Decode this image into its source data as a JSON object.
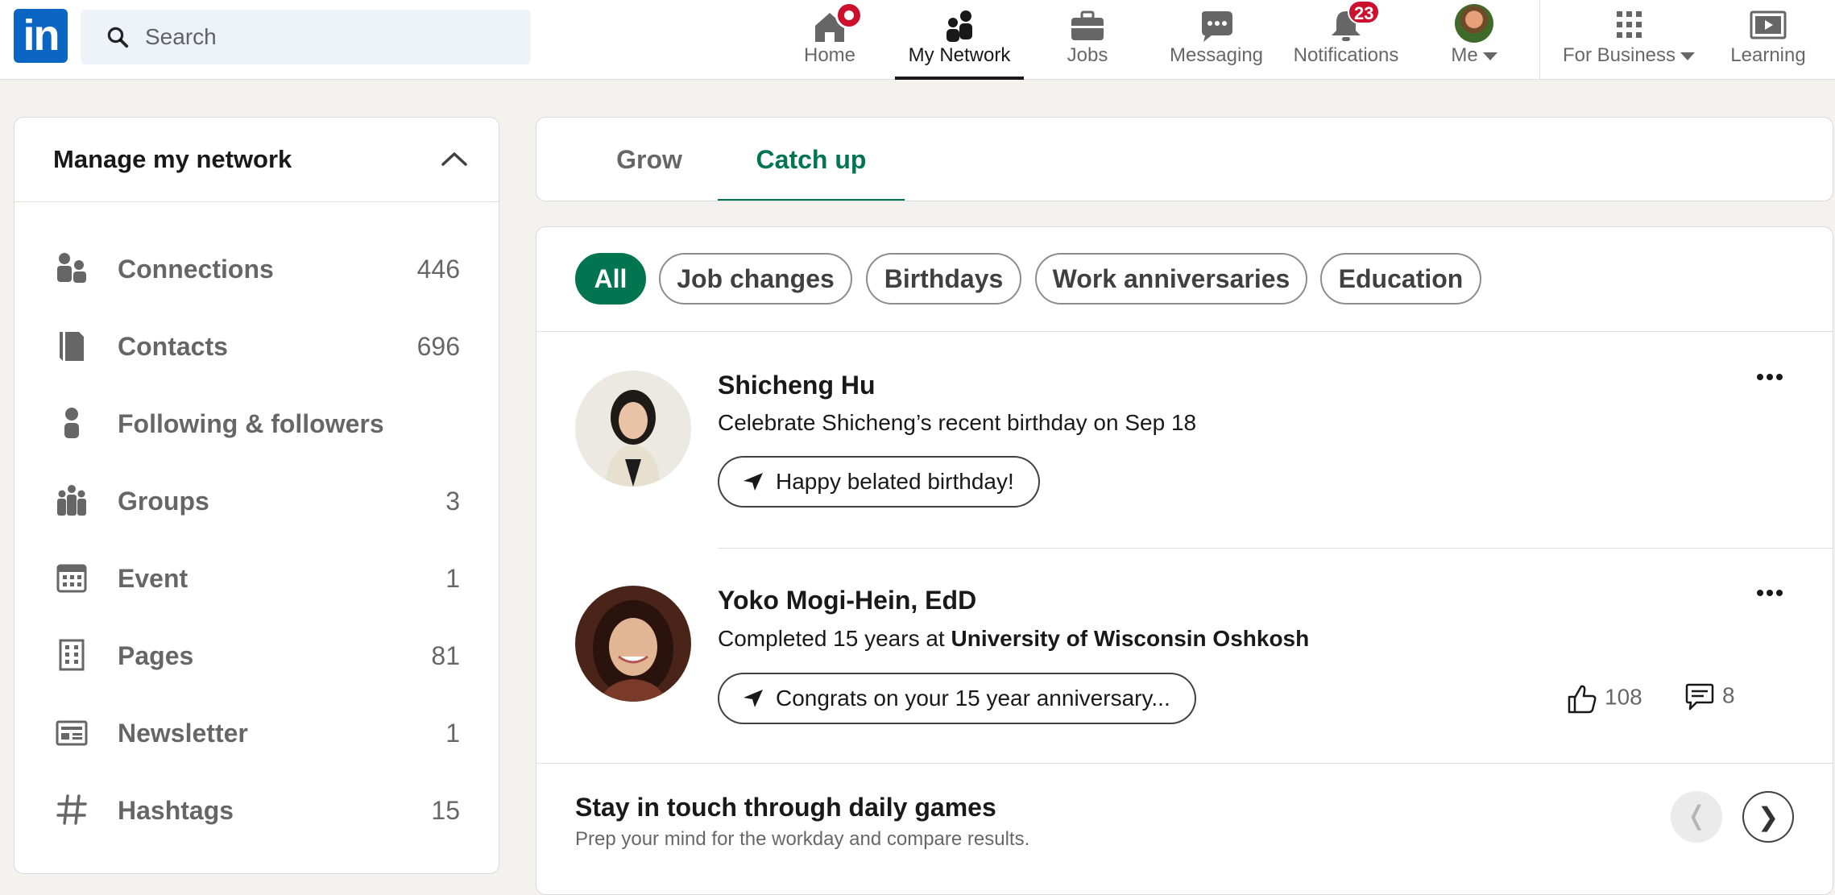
{
  "brand": {
    "logo_text": "in",
    "accent": "#0a66c2",
    "green": "#01754f",
    "badge_red": "#cb112d"
  },
  "search": {
    "placeholder": "Search",
    "icon": "search-icon"
  },
  "nav": {
    "home": "Home",
    "network": "My Network",
    "jobs": "Jobs",
    "messaging": "Messaging",
    "notifications": "Notifications",
    "notifications_count": "23",
    "me": "Me",
    "business": "For Business",
    "learning": "Learning"
  },
  "sidebar": {
    "title": "Manage my network",
    "items": [
      {
        "label": "Connections",
        "count": "446",
        "icon": "people-icon"
      },
      {
        "label": "Contacts",
        "count": "696",
        "icon": "contact-book-icon"
      },
      {
        "label": "Following & followers",
        "count": "",
        "icon": "person-icon"
      },
      {
        "label": "Groups",
        "count": "3",
        "icon": "group-icon"
      },
      {
        "label": "Event",
        "count": "1",
        "icon": "calendar-icon"
      },
      {
        "label": "Pages",
        "count": "81",
        "icon": "building-icon"
      },
      {
        "label": "Newsletter",
        "count": "1",
        "icon": "newsletter-icon"
      },
      {
        "label": "Hashtags",
        "count": "15",
        "icon": "hashtag-icon"
      }
    ]
  },
  "tabs": [
    {
      "label": "Grow"
    },
    {
      "label": "Catch up"
    }
  ],
  "filters": [
    "All",
    "Job changes",
    "Birthdays",
    "Work anniversaries",
    "Education"
  ],
  "feed": [
    {
      "name": "Shicheng Hu",
      "desc": "Celebrate Shicheng’s recent birthday on Sep 18",
      "button": "Happy belated birthday!"
    },
    {
      "name": "Yoko Mogi-Hein, EdD",
      "desc_prefix": "Completed 15 years at ",
      "desc_org": "University of Wisconsin Oshkosh",
      "button": "Congrats on your 15 year anniversary...",
      "likes": "108",
      "comments": "8"
    }
  ],
  "games": {
    "title": "Stay in touch through daily games",
    "subtitle": "Prep your mind for the workday and compare results.",
    "prev": "❬",
    "next": "❯"
  }
}
